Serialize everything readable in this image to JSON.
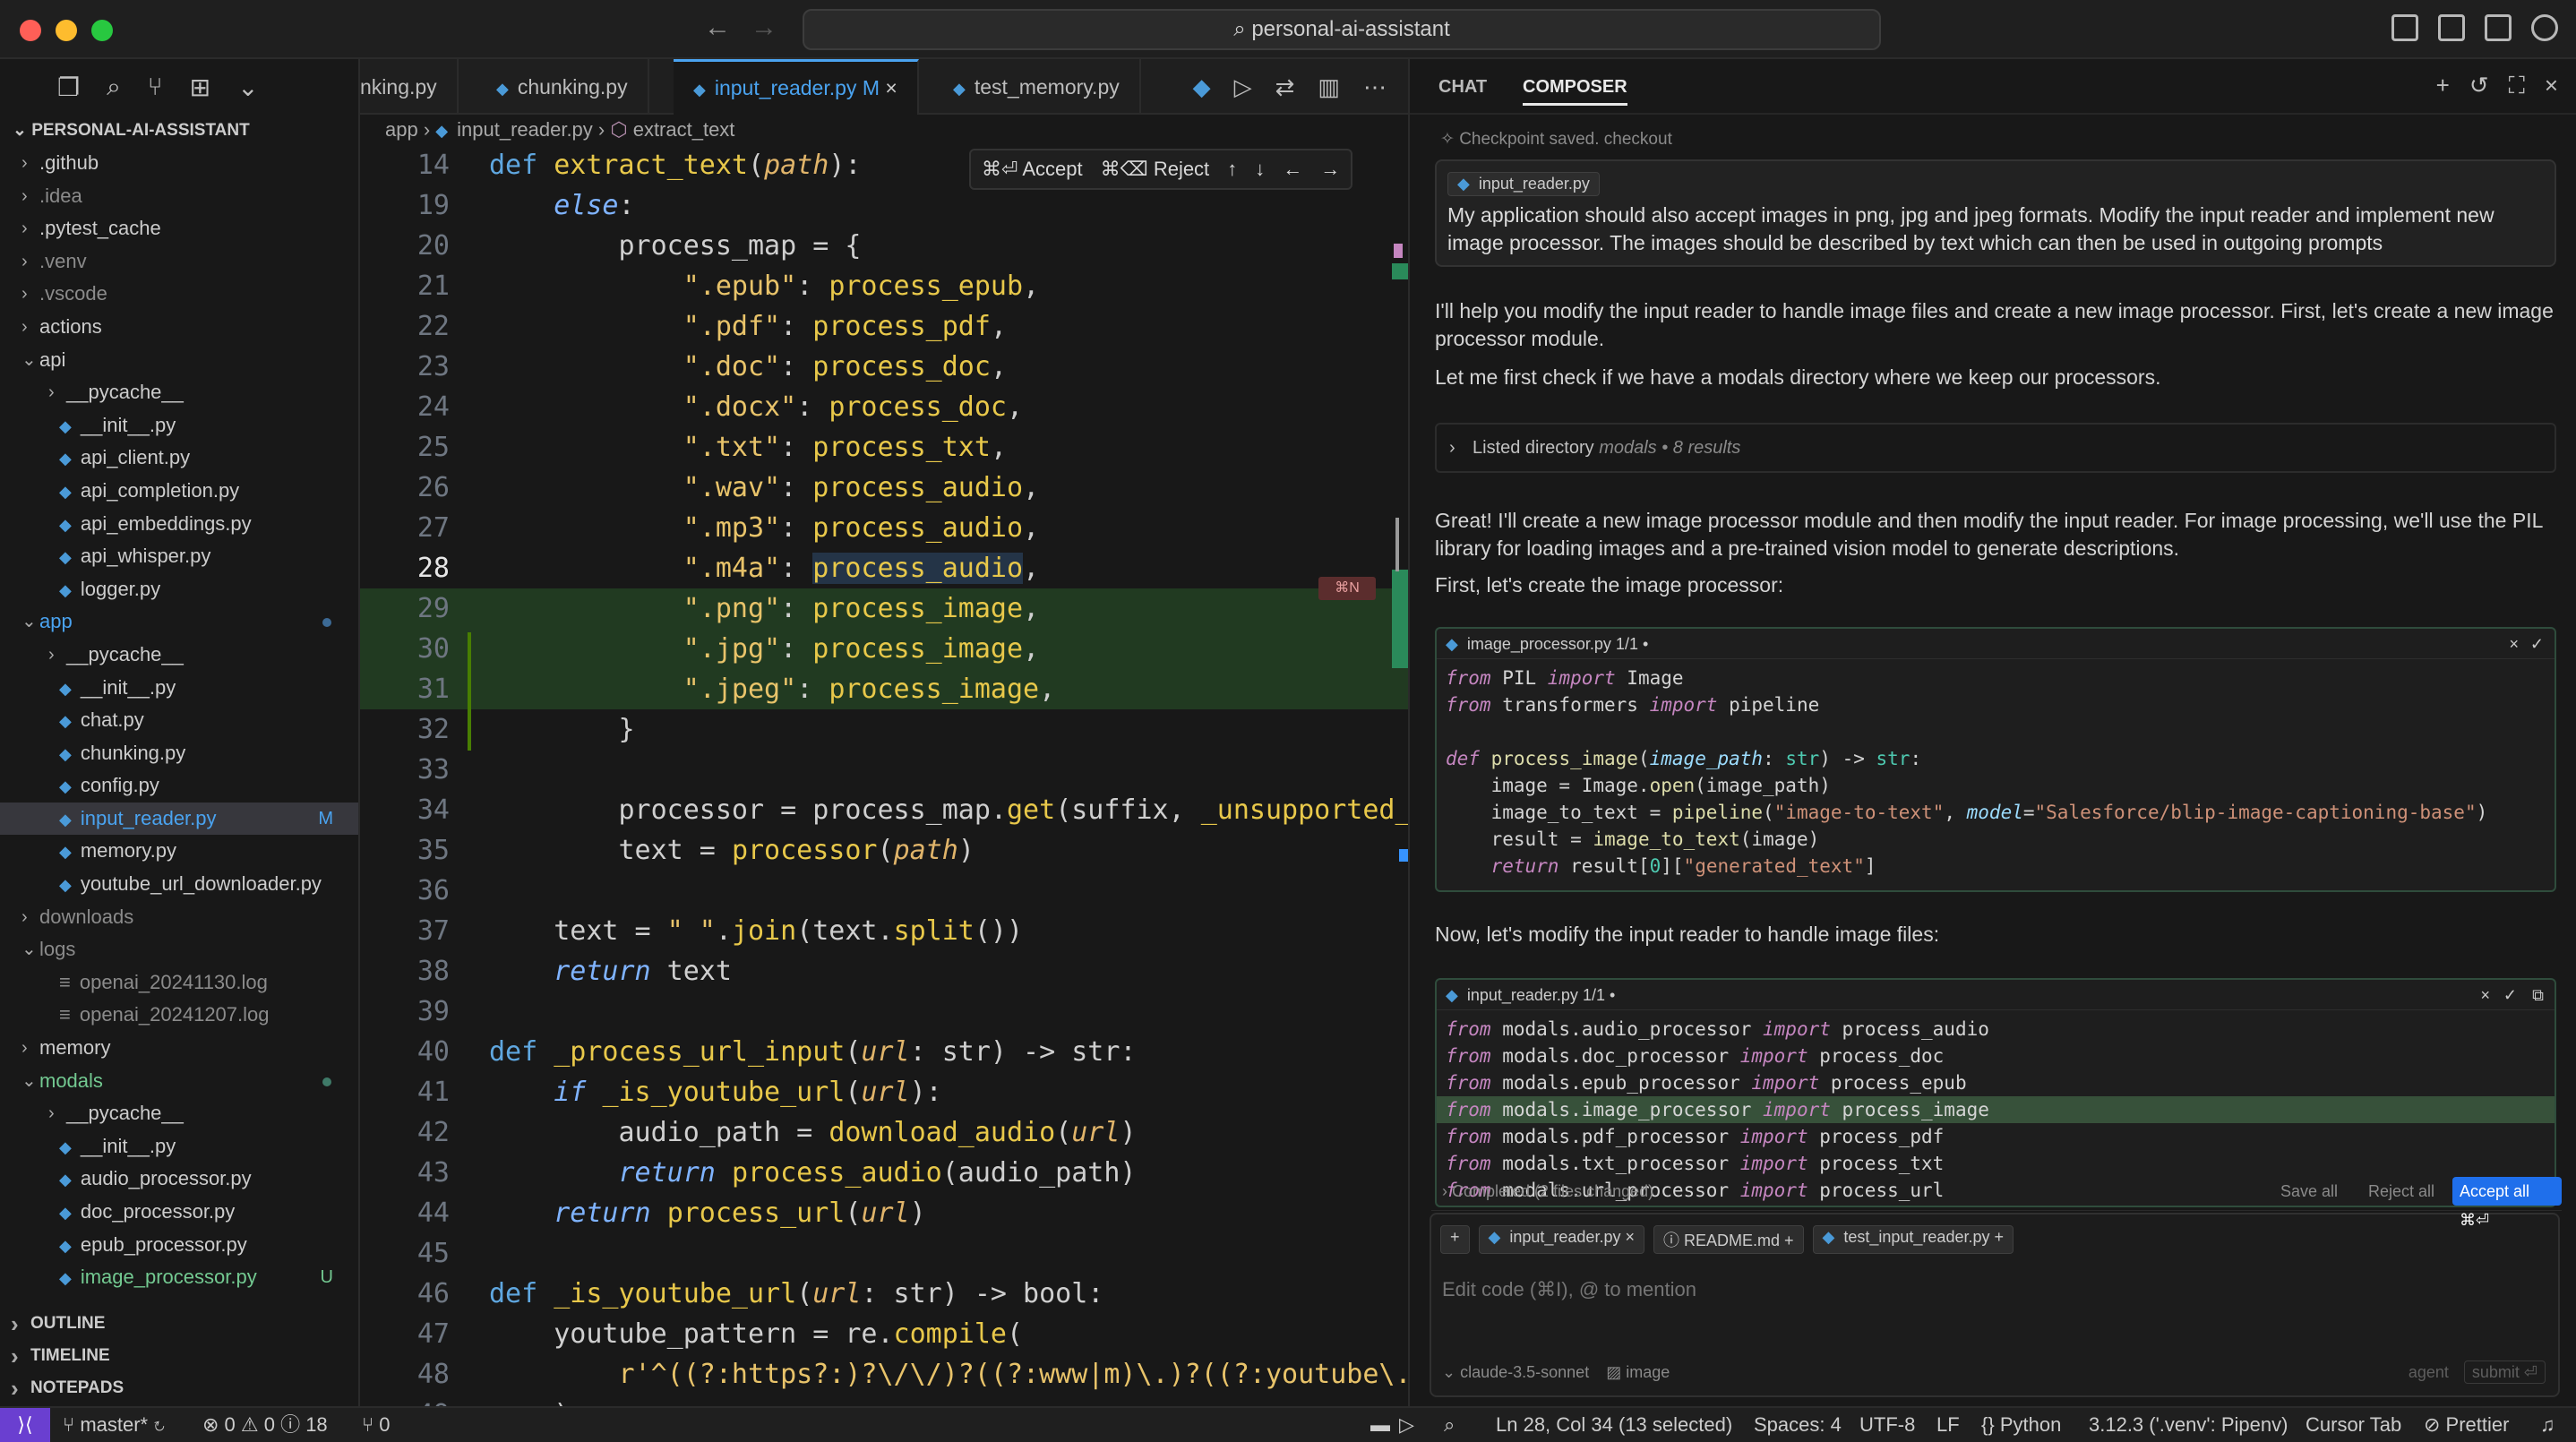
{
  "window": {
    "search": "personal-ai-assistant"
  },
  "explorer": {
    "root": "PERSONAL-AI-ASSISTANT",
    "items": [
      {
        "label": ".github",
        "type": "folder",
        "indent": 0,
        "dim": false
      },
      {
        "label": ".idea",
        "type": "folder",
        "indent": 0,
        "dim": true
      },
      {
        "label": ".pytest_cache",
        "type": "folder",
        "indent": 0,
        "dim": false
      },
      {
        "label": ".venv",
        "type": "folder",
        "indent": 0,
        "dim": true
      },
      {
        "label": ".vscode",
        "type": "folder",
        "indent": 0,
        "dim": true
      },
      {
        "label": "actions",
        "type": "folder",
        "indent": 0,
        "dim": false
      },
      {
        "label": "api",
        "type": "folder-open",
        "indent": 0,
        "dim": false
      },
      {
        "label": "__pycache__",
        "type": "folder",
        "indent": 1,
        "dim": false
      },
      {
        "label": "__init__.py",
        "type": "file",
        "indent": 1,
        "dim": false
      },
      {
        "label": "api_client.py",
        "type": "file",
        "indent": 1,
        "dim": false
      },
      {
        "label": "api_completion.py",
        "type": "file",
        "indent": 1,
        "dim": false
      },
      {
        "label": "api_embeddings.py",
        "type": "file",
        "indent": 1,
        "dim": false
      },
      {
        "label": "api_whisper.py",
        "type": "file",
        "indent": 1,
        "dim": false
      },
      {
        "label": "logger.py",
        "type": "file",
        "indent": 1,
        "dim": false
      },
      {
        "label": "app",
        "type": "folder-open",
        "indent": 0,
        "dim": false,
        "color": "#4aa3f0",
        "dot": true
      },
      {
        "label": "__pycache__",
        "type": "folder",
        "indent": 1,
        "dim": false
      },
      {
        "label": "__init__.py",
        "type": "file",
        "indent": 1,
        "dim": false
      },
      {
        "label": "chat.py",
        "type": "file",
        "indent": 1,
        "dim": false
      },
      {
        "label": "chunking.py",
        "type": "file",
        "indent": 1,
        "dim": false
      },
      {
        "label": "config.py",
        "type": "file",
        "indent": 1,
        "dim": false
      },
      {
        "label": "input_reader.py",
        "type": "file",
        "indent": 1,
        "dim": false,
        "selected": true,
        "badge": "M",
        "color": "#4aa3f0"
      },
      {
        "label": "memory.py",
        "type": "file",
        "indent": 1,
        "dim": false
      },
      {
        "label": "youtube_url_downloader.py",
        "type": "file",
        "indent": 1,
        "dim": false
      },
      {
        "label": "downloads",
        "type": "folder",
        "indent": 0,
        "dim": true
      },
      {
        "label": "logs",
        "type": "folder-open",
        "indent": 0,
        "dim": true
      },
      {
        "label": "openai_20241130.log",
        "type": "log",
        "indent": 1,
        "dim": true
      },
      {
        "label": "openai_20241207.log",
        "type": "log",
        "indent": 1,
        "dim": true
      },
      {
        "label": "memory",
        "type": "folder",
        "indent": 0,
        "dim": false
      },
      {
        "label": "modals",
        "type": "folder-open",
        "indent": 0,
        "dim": false,
        "color": "#73c991",
        "dot": true
      },
      {
        "label": "__pycache__",
        "type": "folder",
        "indent": 1,
        "dim": false
      },
      {
        "label": "__init__.py",
        "type": "file",
        "indent": 1,
        "dim": false
      },
      {
        "label": "audio_processor.py",
        "type": "file",
        "indent": 1,
        "dim": false
      },
      {
        "label": "doc_processor.py",
        "type": "file",
        "indent": 1,
        "dim": false
      },
      {
        "label": "epub_processor.py",
        "type": "file",
        "indent": 1,
        "dim": false
      },
      {
        "label": "image_processor.py",
        "type": "file",
        "indent": 1,
        "dim": false,
        "badge": "U",
        "color": "#73c991"
      }
    ],
    "sections": [
      "OUTLINE",
      "TIMELINE",
      "NOTEPADS"
    ]
  },
  "tabs": [
    {
      "label": "nking.py",
      "active": false
    },
    {
      "label": "chunking.py",
      "active": false
    },
    {
      "label": "input_reader.py",
      "active": true,
      "modified": "M"
    },
    {
      "label": "test_memory.py",
      "active": false
    }
  ],
  "breadcrumb": {
    "folder": "app",
    "file": "input_reader.py",
    "symbol": "extract_text"
  },
  "diff_bar": {
    "accept": "⌘⏎ Accept",
    "reject": "⌘⌫ Reject"
  },
  "shortcut_badge": "⌘N",
  "code_lines": [
    {
      "n": "14",
      "html": "<span class=\"kw\">def</span> <span class=\"fn\">extract_text</span><span class=\"pl\">(</span><span class=\"pm\">path</span><span class=\"pl\">):</span>"
    },
    {
      "n": "19",
      "html": "    <span class=\"kwi\">else</span><span class=\"pl\">:</span>"
    },
    {
      "n": "20",
      "html": "        <span class=\"pl\">process_map = {</span>"
    },
    {
      "n": "21",
      "html": "            <span class=\"str\">\".epub\"</span><span class=\"pl\">: </span><span class=\"fn\">process_epub</span><span class=\"pl\">,</span>"
    },
    {
      "n": "22",
      "html": "            <span class=\"str\">\".pdf\"</span><span class=\"pl\">: </span><span class=\"fn\">process_pdf</span><span class=\"pl\">,</span>"
    },
    {
      "n": "23",
      "html": "            <span class=\"str\">\".doc\"</span><span class=\"pl\">: </span><span class=\"fn\">process_doc</span><span class=\"pl\">,</span>"
    },
    {
      "n": "24",
      "html": "            <span class=\"str\">\".docx\"</span><span class=\"pl\">: </span><span class=\"fn\">process_doc</span><span class=\"pl\">,</span>"
    },
    {
      "n": "25",
      "html": "            <span class=\"str\">\".txt\"</span><span class=\"pl\">: </span><span class=\"fn\">process_txt</span><span class=\"pl\">,</span>"
    },
    {
      "n": "26",
      "html": "            <span class=\"str\">\".wav\"</span><span class=\"pl\">: </span><span class=\"fn\">process_audio</span><span class=\"pl\">,</span>"
    },
    {
      "n": "27",
      "html": "            <span class=\"str\">\".mp3\"</span><span class=\"pl\">: </span><span class=\"fn\">process_audio</span><span class=\"pl\">,</span>"
    },
    {
      "n": "28",
      "html": "            <span class=\"str\">\".m4a\"</span><span class=\"pl\">: </span><span class=\"fn\" style=\"background:#243447\">process_audio</span><span class=\"pl\">,</span>",
      "current": true
    },
    {
      "n": "29",
      "html": "            <span class=\"str\">\".png\"</span><span class=\"pl\">: </span><span class=\"fn\">process_image</span><span class=\"pl\">,</span>",
      "added": true
    },
    {
      "n": "30",
      "html": "            <span class=\"str\">\".jpg\"</span><span class=\"pl\">: </span><span class=\"fn\">process_image</span><span class=\"pl\">,</span>",
      "added": true
    },
    {
      "n": "31",
      "html": "            <span class=\"str\">\".jpeg\"</span><span class=\"pl\">: </span><span class=\"fn\">process_image</span><span class=\"pl\">,</span>",
      "added": true
    },
    {
      "n": "32",
      "html": "        <span class=\"pl\">}</span>"
    },
    {
      "n": "33",
      "html": ""
    },
    {
      "n": "34",
      "html": "        <span class=\"pl\">processor = </span><span class=\"pl\">process_map</span><span class=\"pl\">.</span><span class=\"fn\">get</span><span class=\"pl\">(suffix, </span><span class=\"fn\">_unsupported_</span>"
    },
    {
      "n": "35",
      "html": "        <span class=\"pl\">text = </span><span class=\"fn\">processor</span><span class=\"pl\">(</span><span class=\"pm\">path</span><span class=\"pl\">)</span>"
    },
    {
      "n": "36",
      "html": ""
    },
    {
      "n": "37",
      "html": "    <span class=\"pl\">text = </span><span class=\"str\">\" \"</span><span class=\"pl\">.</span><span class=\"fn\">join</span><span class=\"pl\">(text.</span><span class=\"fn\">split</span><span class=\"pl\">())</span>"
    },
    {
      "n": "38",
      "html": "    <span class=\"kwi\">return</span><span class=\"pl\"> text</span>"
    },
    {
      "n": "39",
      "html": ""
    },
    {
      "n": "40",
      "html": "<span class=\"kw\">def</span> <span class=\"fn\">_process_url_input</span><span class=\"pl\">(</span><span class=\"pm\">url</span><span class=\"pl\">: str) -&gt; str:</span>"
    },
    {
      "n": "41",
      "html": "    <span class=\"kwi\">if</span> <span class=\"fn\">_is_youtube_url</span><span class=\"pl\">(</span><span class=\"pm\">url</span><span class=\"pl\">):</span>"
    },
    {
      "n": "42",
      "html": "        <span class=\"pl\">audio_path = </span><span class=\"fn\">download_audio</span><span class=\"pl\">(</span><span class=\"pm\">url</span><span class=\"pl\">)</span>"
    },
    {
      "n": "43",
      "html": "        <span class=\"kwi\">return</span> <span class=\"fn\">process_audio</span><span class=\"pl\">(audio_path)</span>"
    },
    {
      "n": "44",
      "html": "    <span class=\"kwi\">return</span> <span class=\"fn\">process_url</span><span class=\"pl\">(</span><span class=\"pm\">url</span><span class=\"pl\">)</span>"
    },
    {
      "n": "45",
      "html": ""
    },
    {
      "n": "46",
      "html": "<span class=\"kw\">def</span> <span class=\"fn\">_is_youtube_url</span><span class=\"pl\">(</span><span class=\"pm\">url</span><span class=\"pl\">: str) -&gt; bool:</span>"
    },
    {
      "n": "47",
      "html": "    <span class=\"pl\">youtube_pattern = re.</span><span class=\"fn\">compile</span><span class=\"pl\">(</span>"
    },
    {
      "n": "48",
      "html": "        <span class=\"str\">r'^((?:https?:)?\\/\\/)?((?:www|m)\\.)?((?:youtube\\.</span>"
    },
    {
      "n": "49",
      "html": "    <span class=\"pl\">)</span>"
    }
  ],
  "chat": {
    "tab_chat": "CHAT",
    "tab_composer": "COMPOSER",
    "checkpoint": "Checkpoint saved. checkout",
    "user_file_chip": "input_reader.py",
    "user_message": "My application should also accept images in png, jpg and jpeg formats. Modify the input reader and implement new image processor. The images should be described by text which can then be used in outgoing prompts",
    "reply_1": "I'll help you modify the input reader to handle image files and create a new image processor. First, let's create a new image processor module.",
    "reply_2": "Let me first check if we have a modals directory where we keep our processors.",
    "listed_dir": "Listed directory",
    "listed_dir_detail": "modals • 8 results",
    "reply_3": "Great! I'll create a new image processor module and then modify the input reader. For image processing, we'll use the PIL library for loading images and a pre-trained vision model to generate descriptions.",
    "reply_4": "First, let's create the image processor:",
    "block1_title": "image_processor.py  1/1 •",
    "block1_html": "<span class=\"bkw\">from</span> PIL <span class=\"bkw\">import</span> Image\n<span class=\"bkw\">from</span> transformers <span class=\"bkw\">import</span> pipeline\n\n<span class=\"bkw\">def</span> <span class=\"bfn\">process_image</span>(<span class=\"bprm\">image_path</span>: <span class=\"bty\">str</span>) -&gt; <span class=\"bty\">str</span>:\n    image = Image.<span class=\"bfn\">open</span>(image_path)\n    image_to_text = <span class=\"bfn\">pipeline</span>(<span class=\"bst\">\"image-to-text\"</span>, <span class=\"bprm\">model</span>=<span class=\"bst\">\"Salesforce/blip-image-captioning-base\"</span>)\n    result = <span class=\"bfn\">image_to_text</span>(image)\n    <span class=\"bkw\">return</span> result[<span class=\"bty\">0</span>][<span class=\"bst\">\"generated_text\"</span>]",
    "reply_5": "Now, let's modify the input reader to handle image files:",
    "block2_title": "input_reader.py  1/1 •",
    "block2_lines": [
      {
        "html": "<span class=\"bkw\">from</span> modals.audio_processor <span class=\"bkw\">import</span> process_audio"
      },
      {
        "html": "<span class=\"bkw\">from</span> modals.doc_processor <span class=\"bkw\">import</span> process_doc"
      },
      {
        "html": "<span class=\"bkw\">from</span> modals.epub_processor <span class=\"bkw\">import</span> process_epub"
      },
      {
        "html": "<span class=\"bkw\">from</span> modals.image_processor <span class=\"bkw\">import</span> process_image",
        "hl": true
      },
      {
        "html": "<span class=\"bkw\">from</span> modals.pdf_processor <span class=\"bkw\">import</span> process_pdf"
      },
      {
        "html": "<span class=\"bkw\">from</span> modals.txt_processor <span class=\"bkw\">import</span> process_txt"
      },
      {
        "html": "<span class=\"bkw\">from</span> modals.url_processor <span class=\"bkw\">import</span> process_url"
      }
    ],
    "completed": "Completed (2 files changed)",
    "save_all": "Save all",
    "reject_all": "Reject all",
    "accept_all": "Accept all ⌘⏎",
    "context_chips": [
      "input_reader.py",
      "README.md",
      "test_input_reader.py"
    ],
    "input_placeholder": "Edit code (⌘I), @ to mention",
    "model": "claude-3.5-sonnet",
    "image_label": "image",
    "agent_label": "agent",
    "submit_label": "submit ⏎"
  },
  "status": {
    "branch": "master*",
    "problems": "⊗ 0 ⚠ 0 ⓘ 18",
    "ports": "⑂ 0",
    "position": "Ln 28, Col 34 (13 selected)",
    "spaces": "Spaces: 4",
    "encoding": "UTF-8",
    "eol": "LF",
    "language": "Python",
    "interpreter": "3.12.3 ('.venv': Pipenv)",
    "cursor_tab": "Cursor Tab",
    "prettier": "Prettier"
  }
}
